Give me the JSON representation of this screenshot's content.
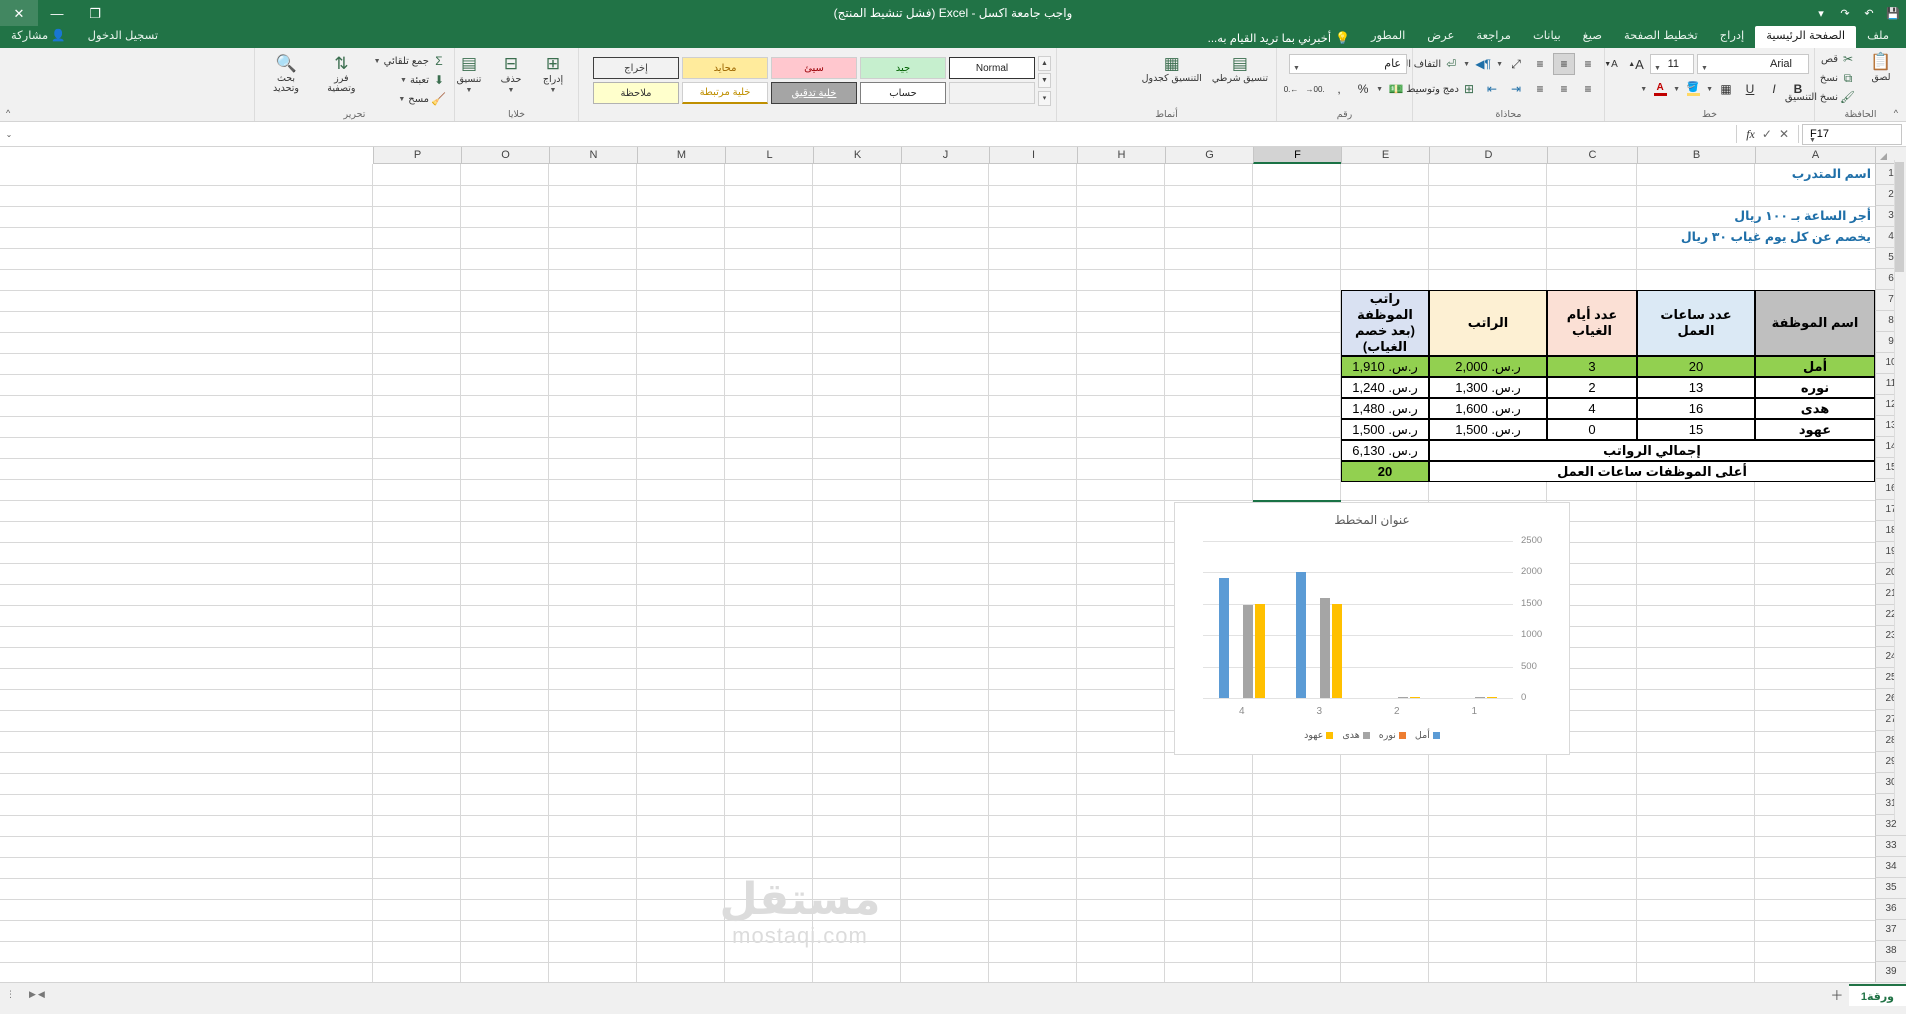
{
  "titlebar": {
    "title": "واجب جامعة اكسل - Excel (فشل تنشيط المنتج)",
    "close_icon": "✕",
    "minimize_icon": "—",
    "maximize_icon": "❐",
    "restore_icon": "⧉",
    "save_icon": "💾",
    "undo_icon": "↶",
    "redo_icon": "↷",
    "customize_icon": "▾",
    "help_icon": "?",
    "ribbon_options_icon": "▭",
    "signin_label": "تسجيل الدخول",
    "share_label": "مشاركة",
    "share_icon": "person-share-icon"
  },
  "tabs": [
    {
      "label": "ملف",
      "active": false
    },
    {
      "label": "الصفحة الرئيسية",
      "active": true
    },
    {
      "label": "إدراج",
      "active": false
    },
    {
      "label": "تخطيط الصفحة",
      "active": false
    },
    {
      "label": "صيغ",
      "active": false
    },
    {
      "label": "بيانات",
      "active": false
    },
    {
      "label": "مراجعة",
      "active": false
    },
    {
      "label": "عرض",
      "active": false
    },
    {
      "label": "المطور",
      "active": false
    }
  ],
  "tellme": "أخبرني بما تريد القيام به...",
  "ribbon": {
    "groups": {
      "clipboard": {
        "label": "الحافظة",
        "paste_label": "لصق",
        "cut_label": "قص",
        "copy_label": "نسخ",
        "format_painter_label": "نسخ التنسيق",
        "paste_icon": "clipboard-icon",
        "cut_icon": "scissors-icon",
        "copy_icon": "copy-icon",
        "painter_icon": "paintbrush-icon"
      },
      "font": {
        "label": "خط",
        "font_name": "Arial",
        "font_size": "11",
        "bold_label": "B",
        "italic_label": "I",
        "underline_label": "U",
        "grow_font_label": "A",
        "shrink_font_label": "A",
        "borders_icon": "borders-icon",
        "fill_color_icon": "fill-color-icon",
        "font_color_icon": "font-color-icon"
      },
      "alignment": {
        "label": "محاذاة",
        "wrap_text_label": "التفاف النص",
        "merge_center_label": "دمج وتوسيط",
        "rtl_icon": "text-direction-rtl-icon",
        "orientation_icon": "orientation-icon",
        "indent_inc_icon": "increase-indent-icon",
        "indent_dec_icon": "decrease-indent-icon"
      },
      "number": {
        "label": "رقم",
        "format_value": "عام",
        "percent_label": "%",
        "comma_label": ",",
        "currency_icon": "currency-icon",
        "inc_dec_label": ".00",
        "dec_dec_label": ".0"
      },
      "styles": {
        "label": "أنماط",
        "conditional_label": "تنسيق شرطي",
        "table_format_label": "التنسيق كجدول",
        "cell_styles_top": [
          "Normal",
          "جيد",
          "سيئ",
          "محايد",
          "إخراج"
        ],
        "cell_styles_bottom": [
          "",
          "حساب",
          "خلية تدقيق",
          "خلية مرتبطة",
          "ملاحظة"
        ]
      },
      "cells": {
        "label": "خلايا",
        "insert_label": "إدراج",
        "delete_label": "حذف",
        "format_label": "تنسيق"
      },
      "editing": {
        "label": "تحرير",
        "autosum_label": "جمع تلقائي",
        "fill_label": "تعبئة",
        "clear_label": "مسح",
        "sort_filter_label": "فرز وتصفية",
        "find_select_label": "بحث وتحديد",
        "sigma_icon": "sigma-icon",
        "sort_icon": "sort-az-icon",
        "find_icon": "magnifier-icon"
      }
    }
  },
  "formula_bar": {
    "name_box": "F17",
    "formula_value": "",
    "cancel_icon": "✕",
    "confirm_icon": "✓",
    "fx_icon": "fx",
    "expand_icon": "⌄"
  },
  "grid": {
    "columns": [
      "A",
      "B",
      "C",
      "D",
      "E",
      "F",
      "G",
      "H",
      "I",
      "J",
      "K",
      "L",
      "M",
      "N",
      "O",
      "P"
    ],
    "selected_column": "F",
    "selected_cell": "F17",
    "notes": [
      {
        "ref": "A1",
        "text": "اسم المتدرب"
      },
      {
        "ref": "A3",
        "text": "أجر الساعة بـ ١٠٠ ريال"
      },
      {
        "ref": "A4",
        "text": "يخصم عن كل يوم غياب ٣٠ ريال"
      }
    ]
  },
  "table": {
    "headers": [
      "اسم الموظفة",
      "عدد ساعات العمل",
      "عدد أيام الغياب",
      "الراتب",
      "راتب الموظفة (بعد خصم الغياب)"
    ],
    "header_colors": [
      "#bfbfbf",
      "#dbe9f5",
      "#fbe0d5",
      "#fdf0d3",
      "#d9e1f2"
    ],
    "rows": [
      {
        "name": "أمل",
        "hours": "20",
        "absence": "3",
        "salary": "ر.س. 2,000",
        "net": "ر.س. 1,910",
        "highlight": true
      },
      {
        "name": "نوره",
        "hours": "13",
        "absence": "2",
        "salary": "ر.س. 1,300",
        "net": "ر.س. 1,240",
        "highlight": false
      },
      {
        "name": "هدى",
        "hours": "16",
        "absence": "4",
        "salary": "ر.س. 1,600",
        "net": "ر.س. 1,480",
        "highlight": false
      },
      {
        "name": "عهود",
        "hours": "15",
        "absence": "0",
        "salary": "ر.س. 1,500",
        "net": "ر.س. 1,500",
        "highlight": false
      }
    ],
    "total_row": {
      "label": "إجمالي الرواتب",
      "value": "ر.س. 6,130"
    },
    "max_row": {
      "label": "أعلى الموظفات ساعات العمل",
      "value": "20"
    },
    "highlight_color": "#92d050"
  },
  "chart_data": {
    "type": "bar",
    "title": "عنوان المخطط",
    "categories": [
      "1",
      "2",
      "3",
      "4"
    ],
    "series": [
      {
        "name": "أمل",
        "color": "#5b9bd5",
        "values": [
          0,
          0,
          2000,
          1910
        ]
      },
      {
        "name": "نوره",
        "color": "#ed7d31",
        "values": [
          0,
          0,
          0,
          0
        ]
      },
      {
        "name": "هدى",
        "color": "#a5a5a5",
        "values": [
          20,
          15,
          1600,
          1480
        ]
      },
      {
        "name": "عهود",
        "color": "#ffc000",
        "values": [
          16,
          13,
          1500,
          1500
        ]
      }
    ],
    "yticks": [
      "0",
      "500",
      "1000",
      "1500",
      "2000",
      "2500"
    ],
    "ylim": [
      0,
      2500
    ],
    "legend_position": "bottom",
    "grid": true,
    "xlabel": "",
    "ylabel": ""
  },
  "watermark": {
    "arabic": "مستقل",
    "latin": "mostaqi.com"
  },
  "sheetbar": {
    "sheet_tab": "ورقة1",
    "add_sheet_icon": "＋",
    "first_icon": "◀◀",
    "prev_icon": "◀",
    "next_icon": "▶",
    "last_icon": "▶▶",
    "menu_icon": "⋮"
  }
}
